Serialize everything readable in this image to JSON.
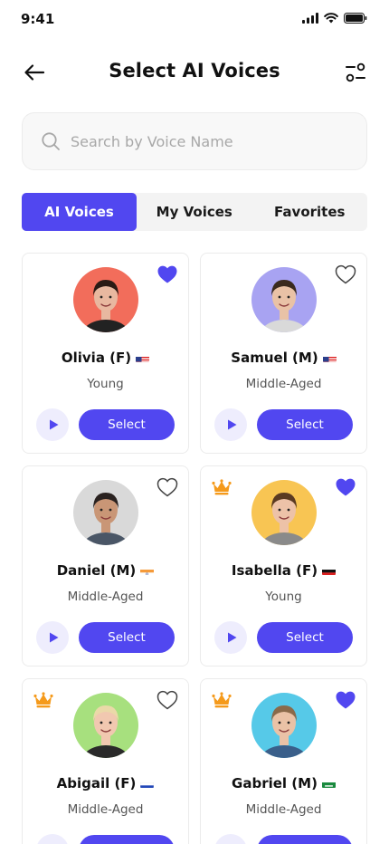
{
  "status_bar": {
    "time": "9:41"
  },
  "header": {
    "title": "Select AI Voices"
  },
  "search": {
    "placeholder": "Search by Voice Name",
    "value": ""
  },
  "tabs": [
    {
      "label": "AI Voices",
      "active": true
    },
    {
      "label": "My Voices",
      "active": false
    },
    {
      "label": "Favorites",
      "active": false
    }
  ],
  "colors": {
    "accent": "#5147f0",
    "crown": "#f59a1b"
  },
  "voices": [
    {
      "name": "Olivia (F)",
      "flag": "us",
      "age": "Young",
      "favorite": true,
      "premium": false,
      "avatar_bg": "#f26d5b",
      "select_label": "Select"
    },
    {
      "name": "Samuel (M)",
      "flag": "us",
      "age": "Middle-Aged",
      "favorite": false,
      "premium": false,
      "avatar_bg": "#a8a3f2",
      "select_label": "Select"
    },
    {
      "name": "Daniel (M)",
      "flag": "in",
      "age": "Middle-Aged",
      "favorite": false,
      "premium": false,
      "avatar_bg": "#d9d9d9",
      "select_label": "Select"
    },
    {
      "name": "Isabella (F)",
      "flag": "de",
      "age": "Young",
      "favorite": true,
      "premium": true,
      "avatar_bg": "#f8c553",
      "select_label": "Select"
    },
    {
      "name": "Abigail (F)",
      "flag": "ru",
      "age": "Middle-Aged",
      "favorite": false,
      "premium": true,
      "avatar_bg": "#a7e07e",
      "select_label": "Select"
    },
    {
      "name": "Gabriel (M)",
      "flag": "sa",
      "age": "Middle-Aged",
      "favorite": true,
      "premium": true,
      "avatar_bg": "#56c9e8",
      "select_label": "Select"
    }
  ]
}
